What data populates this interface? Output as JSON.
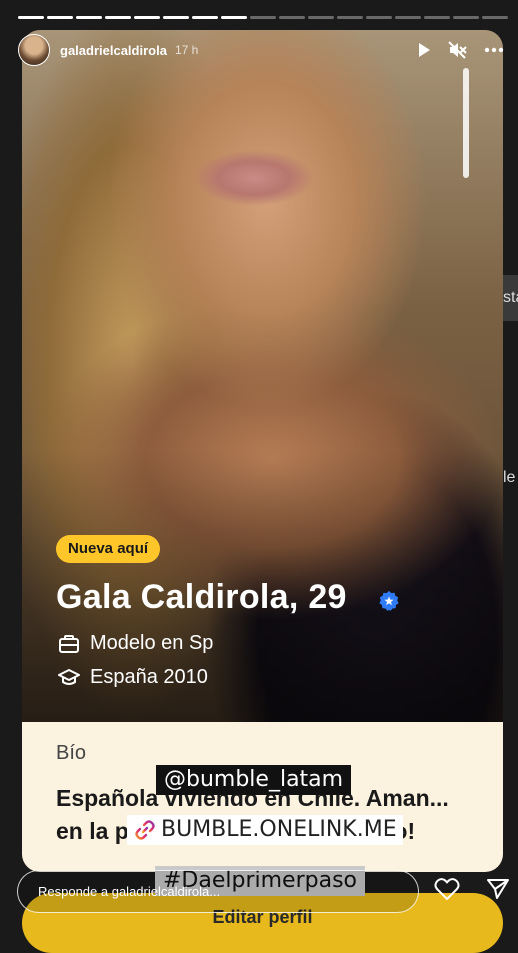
{
  "story": {
    "progress_segments_total": 17,
    "progress_segments_done": 8
  },
  "header": {
    "username": "galadrielcaldirola",
    "time": "17 h",
    "icons": [
      "play-icon",
      "mute-icon",
      "more-icon"
    ]
  },
  "card": {
    "badge": "Nueva aquí",
    "name": "Gala Caldirola, 29",
    "job": "Modelo en Sp",
    "education": "España 2010",
    "bio_title": "Bío",
    "bio_text": "Española viviendo en Chile. Aman... en la playa , el vino y lo genuino!"
  },
  "stickers": {
    "mention": "@bumble_latam",
    "link": "BUMBLE.ONELINK.ME",
    "hashtag": "#Daelprimerpaso"
  },
  "cta": {
    "label": "Editar perfil"
  },
  "peek": {
    "top_text": "sta",
    "bottom_text": "le"
  },
  "reply": {
    "placeholder": "Responde a galadrielcaldirola..."
  },
  "colors": {
    "badge_bg": "#ffc629",
    "bio_bg": "#fbf3df",
    "cta_bg": "#e7b91c",
    "verified": "#2f7bf6"
  }
}
